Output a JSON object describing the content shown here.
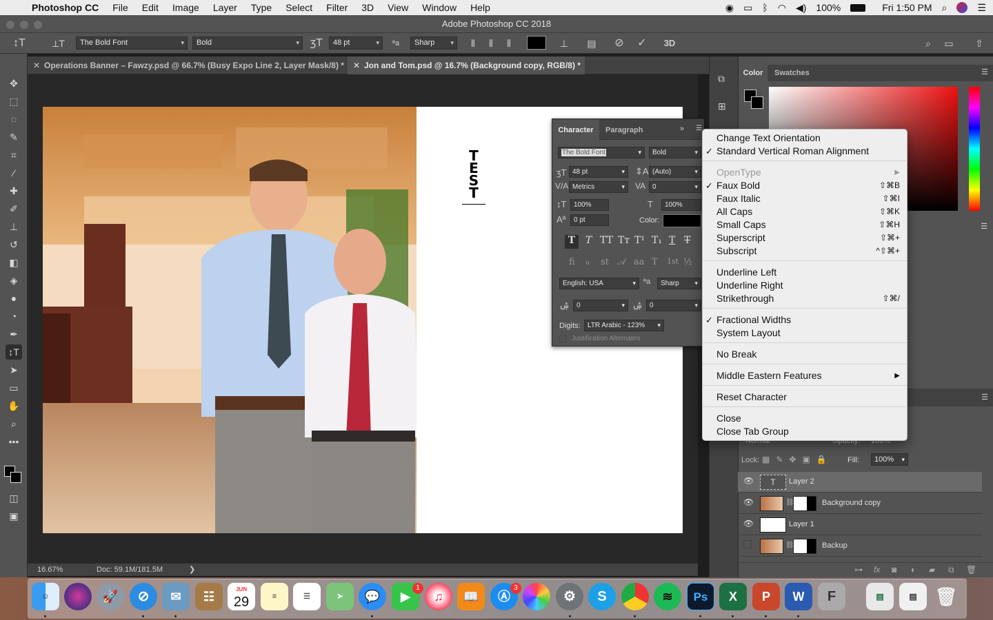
{
  "menubar": {
    "app_name": "Photoshop CC",
    "items": [
      "File",
      "Edit",
      "Image",
      "Layer",
      "Type",
      "Select",
      "Filter",
      "3D",
      "View",
      "Window",
      "Help"
    ],
    "battery": "100%",
    "clock": "Fri 1:50 PM"
  },
  "window": {
    "title": "Adobe Photoshop CC 2018"
  },
  "options_bar": {
    "font_family": "The Bold Font",
    "font_style": "Bold",
    "font_size": "48 pt",
    "anti_alias": "Sharp",
    "text_color": "#000000"
  },
  "tabs": [
    {
      "label": "Operations Banner – Fawzy.psd @ 66.7% (Busy Expo Line 2, Layer Mask/8) *"
    },
    {
      "label": "Jon and Tom.psd @ 16.7% (Background copy, RGB/8) *"
    }
  ],
  "canvas": {
    "vertical_text": "TEST"
  },
  "status_bar": {
    "zoom": "16.67%",
    "doc_size": "Doc: 59.1M/181.5M"
  },
  "character_panel": {
    "tabs": [
      "Character",
      "Paragraph"
    ],
    "font_family": "The Bold Font",
    "font_style": "Bold",
    "font_size": "48 pt",
    "leading": "(Auto)",
    "kerning": "Metrics",
    "tracking": "0",
    "vertical_scale": "100%",
    "horizontal_scale": "100%",
    "baseline_shift": "0 pt",
    "color_label": "Color:",
    "language": "English: USA",
    "anti_alias": "Sharp",
    "indic_1": "0",
    "indic_2": "0",
    "digits_label": "Digits:",
    "digits_value": "LTR Arabic - 123%",
    "justification_alternates": "Justification Alternates"
  },
  "context_menu": {
    "change_text_orientation": "Change Text Orientation",
    "standard_vertical_roman": "Standard Vertical Roman Alignment",
    "opentype": "OpenType",
    "faux_bold": "Faux Bold",
    "faux_bold_sc": "⇧⌘B",
    "faux_italic": "Faux Italic",
    "faux_italic_sc": "⇧⌘I",
    "all_caps": "All Caps",
    "all_caps_sc": "⇧⌘K",
    "small_caps": "Small Caps",
    "small_caps_sc": "⇧⌘H",
    "superscript": "Superscript",
    "superscript_sc": "⇧⌘+",
    "subscript": "Subscript",
    "subscript_sc": "^⇧⌘+",
    "underline_left": "Underline Left",
    "underline_right": "Underline Right",
    "strikethrough": "Strikethrough",
    "strikethrough_sc": "⇧⌘/",
    "fractional_widths": "Fractional Widths",
    "system_layout": "System Layout",
    "no_break": "No Break",
    "middle_eastern": "Middle Eastern Features",
    "reset_character": "Reset Character",
    "close": "Close",
    "close_tab_group": "Close Tab Group"
  },
  "right_panel": {
    "color_tab": "Color",
    "swatches_tab": "Swatches",
    "blend_mode": "Normal",
    "opacity_label": "Opacity:",
    "opacity": "100%",
    "lock_label": "Lock:",
    "fill_label": "Fill:",
    "fill": "100%"
  },
  "layers": [
    {
      "name": "Layer 2",
      "visible": true
    },
    {
      "name": "Background copy",
      "visible": true
    },
    {
      "name": "Layer 1",
      "visible": true
    },
    {
      "name": "Backup",
      "visible": false
    }
  ],
  "dock": {
    "calendar_month": "JUN",
    "calendar_day": "29",
    "facetime_badge": "1",
    "appstore_badge": "3"
  }
}
